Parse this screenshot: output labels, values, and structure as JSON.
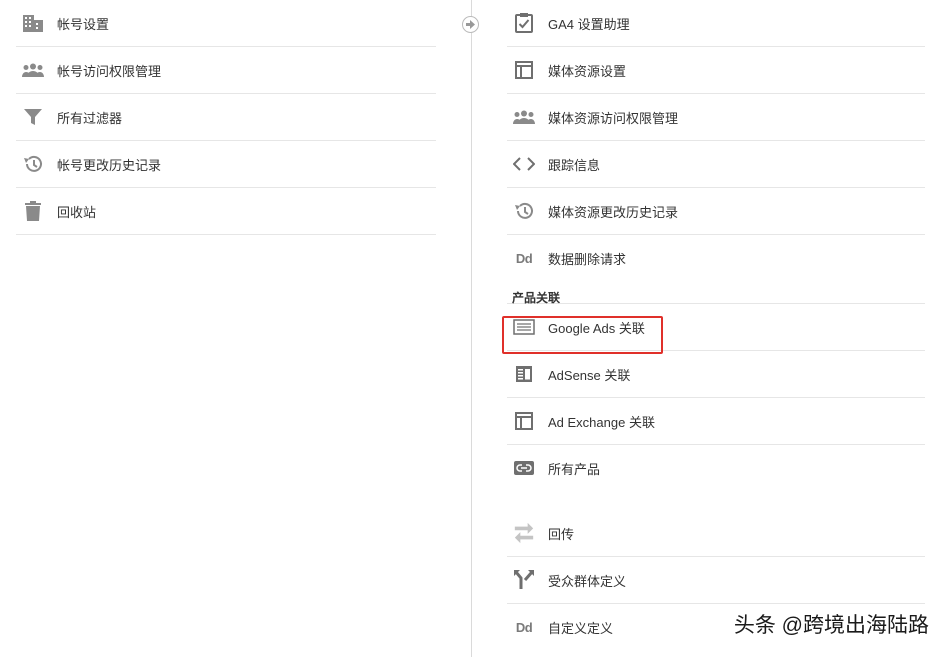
{
  "account": {
    "items": [
      {
        "label": "帐号设置",
        "icon": "building-icon"
      },
      {
        "label": "帐号访问权限管理",
        "icon": "people-icon"
      },
      {
        "label": "所有过滤器",
        "icon": "filter-icon"
      },
      {
        "label": "帐号更改历史记录",
        "icon": "history-icon"
      },
      {
        "label": "回收站",
        "icon": "trash-icon"
      }
    ]
  },
  "property": {
    "items": [
      {
        "label": "GA4 设置助理",
        "icon": "clipboard-check-icon"
      },
      {
        "label": "媒体资源设置",
        "icon": "property-window-icon"
      },
      {
        "label": "媒体资源访问权限管理",
        "icon": "people-icon"
      },
      {
        "label": "跟踪信息",
        "icon": "code-icon"
      },
      {
        "label": "媒体资源更改历史记录",
        "icon": "history-icon"
      },
      {
        "label": "数据删除请求",
        "icon": "dd-icon"
      }
    ],
    "section_title": "产品关联",
    "links": [
      {
        "label": "Google Ads 关联",
        "icon": "google-ads-icon",
        "highlighted": true
      },
      {
        "label": "AdSense 关联",
        "icon": "adsense-icon"
      },
      {
        "label": "Ad Exchange 关联",
        "icon": "ad-exchange-icon"
      },
      {
        "label": "所有产品",
        "icon": "link-icon"
      }
    ],
    "more": [
      {
        "label": "回传",
        "icon": "postback-icon"
      },
      {
        "label": "受众群体定义",
        "icon": "audience-fork-icon"
      },
      {
        "label": "自定义定义",
        "icon": "dd-icon"
      }
    ]
  },
  "highlight_color": "#e0302a",
  "watermark": "头条 @跨境出海陆路"
}
